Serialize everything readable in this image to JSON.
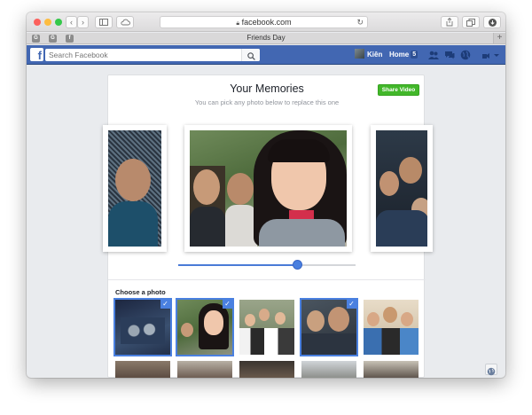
{
  "browser": {
    "url": "facebook.com",
    "tab_title": "Friends Day",
    "tab_favicons": [
      "G",
      "G",
      "f"
    ],
    "new_tab_symbol": "+"
  },
  "facebook": {
    "search_placeholder": "Search Facebook",
    "user_name": "Kiên",
    "home_label": "Home",
    "home_count": "5"
  },
  "memories": {
    "title": "Your Memories",
    "subtitle": "You can pick any photo below to replace this one",
    "share_button": "Share Video",
    "slider_position": 0.67
  },
  "chooser": {
    "label": "Choose a photo",
    "check_glyph": "✓",
    "row1_selected": [
      true,
      true,
      false,
      true,
      false
    ]
  },
  "colors": {
    "facebook_blue": "#4267b2",
    "share_green": "#42b72a",
    "accent_blue": "#4a80e0"
  }
}
